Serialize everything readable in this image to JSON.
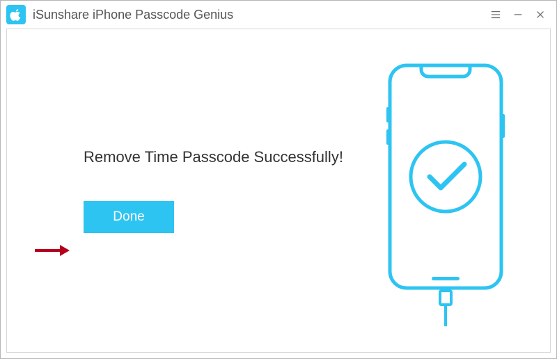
{
  "app": {
    "title": "iSunshare iPhone Passcode Genius"
  },
  "main": {
    "message": "Remove Time Passcode Successfully!",
    "done_label": "Done"
  },
  "colors": {
    "accent": "#2ec4f2",
    "arrow": "#b5001d"
  }
}
